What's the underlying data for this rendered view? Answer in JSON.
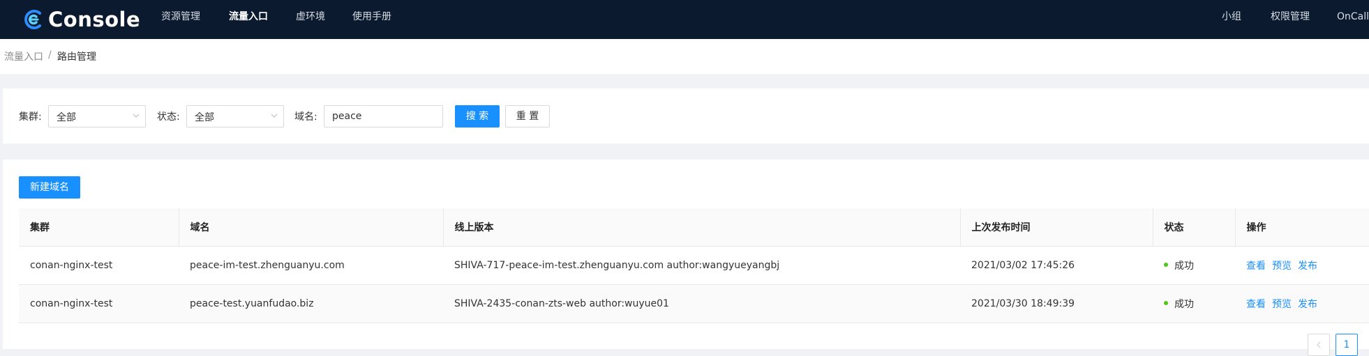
{
  "header": {
    "app_title": "Console",
    "nav": [
      {
        "label": "资源管理",
        "active": false
      },
      {
        "label": "流量入口",
        "active": true
      },
      {
        "label": "虚环境",
        "active": false
      },
      {
        "label": "使用手册",
        "active": false
      }
    ],
    "right_nav": [
      {
        "label": "小组"
      },
      {
        "label": "权限管理"
      },
      {
        "label": "OnCall"
      }
    ],
    "brand_color": "#0b1a2e",
    "logo_icon": "console-logo-icon"
  },
  "breadcrumb": {
    "parent": "流量入口",
    "separator": "/",
    "current": "路由管理"
  },
  "filters": {
    "cluster": {
      "label": "集群",
      "value": "全部"
    },
    "status": {
      "label": "状态",
      "value": "全部"
    },
    "domain": {
      "label": "域名",
      "value": "peace"
    },
    "search_label": "搜 索",
    "reset_label": "重 置"
  },
  "table": {
    "create_label": "新建域名",
    "columns": [
      "集群",
      "域名",
      "线上版本",
      "上次发布时间",
      "状态",
      "操作"
    ],
    "rows": [
      {
        "cluster": "conan-nginx-test",
        "domain": "peace-im-test.zhenguanyu.com",
        "version": "SHIVA-717-peace-im-test.zhenguanyu.com author:wangyueyangbj",
        "published": "2021/03/02 17:45:26",
        "status": "成功",
        "actions": [
          "查看",
          "预览",
          "发布"
        ]
      },
      {
        "cluster": "conan-nginx-test",
        "domain": "peace-test.yuanfudao.biz",
        "version": "SHIVA-2435-conan-zts-web author:wuyue01",
        "published": "2021/03/30 18:49:39",
        "status": "成功",
        "actions": [
          "查看",
          "预览",
          "发布"
        ]
      }
    ],
    "status_color": "#52c41a",
    "link_color": "#1890ff"
  },
  "pagination": {
    "prev_icon": "chevron-left-icon",
    "current_page": "1"
  }
}
